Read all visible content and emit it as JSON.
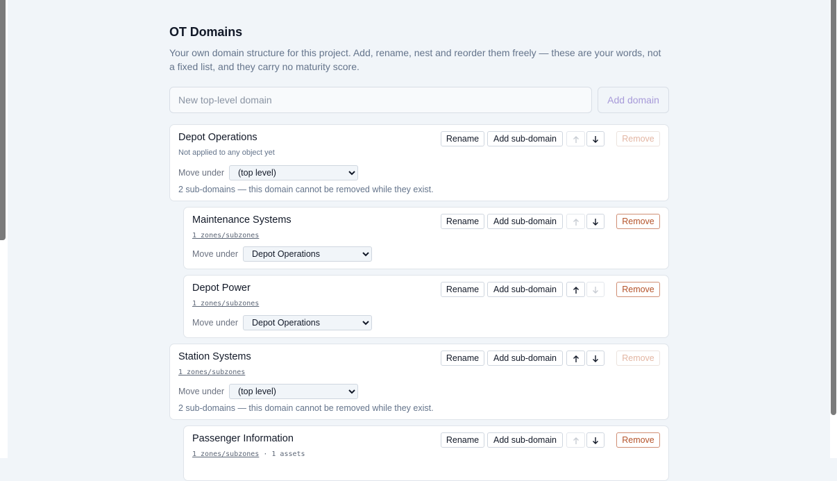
{
  "page": {
    "title": "OT Domains",
    "intro": "Your own domain structure for this project. Add, rename, nest and reorder them freely — these are your words, not a fixed list, and they carry no maturity score."
  },
  "new_domain": {
    "placeholder": "New top-level domain",
    "value": "",
    "add_label": "Add domain"
  },
  "labels": {
    "rename": "Rename",
    "add_sub": "Add sub-domain",
    "remove": "Remove",
    "move_under": "Move under",
    "up_icon": "arrow-up-icon",
    "down_icon": "arrow-down-icon"
  },
  "domains": [
    {
      "name": "Depot Operations",
      "meta_text": "Not applied to any object yet",
      "move_under": "(top level)",
      "note": "2 sub-domains — this domain cannot be removed while they exist."
    },
    {
      "name": "Maintenance Systems",
      "meta_link": "1 zones/subzones",
      "move_under": "Depot Operations"
    },
    {
      "name": "Depot Power",
      "meta_link": "1 zones/subzones",
      "move_under": "Depot Operations"
    },
    {
      "name": "Station Systems",
      "meta_link": "1 zones/subzones",
      "move_under": "(top level)",
      "note": "2 sub-domains — this domain cannot be removed while they exist."
    },
    {
      "name": "Passenger Information",
      "meta_link": "1 zones/subzones",
      "meta_extra": " · 1 assets"
    }
  ]
}
